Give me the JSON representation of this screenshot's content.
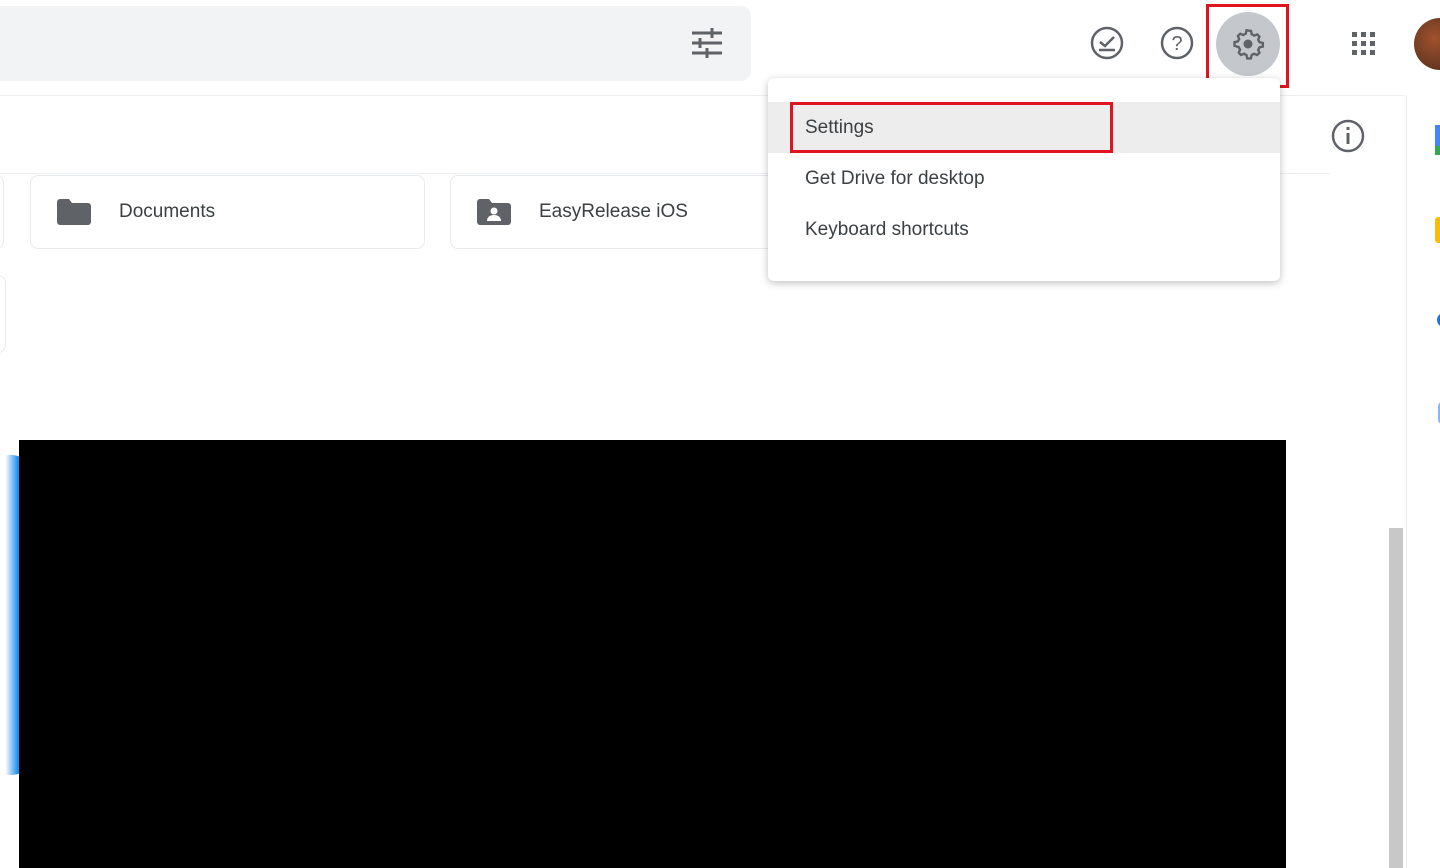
{
  "header": {
    "search_options_icon": "tune-icon",
    "icons": [
      "ready-for-offline-icon",
      "help-icon",
      "settings-gear-icon",
      "apps-grid-icon",
      "avatar"
    ]
  },
  "folders": [
    {
      "name": "Documents",
      "icon": "folder-icon"
    },
    {
      "name": "EasyRelease iOS",
      "icon": "shared-folder-icon"
    }
  ],
  "settings_menu": {
    "items": [
      "Settings",
      "Get Drive for desktop",
      "Keyboard shortcuts"
    ],
    "highlighted": "Settings"
  },
  "colors": {
    "highlight": "#e0141e",
    "accent": "#1a73e8"
  }
}
